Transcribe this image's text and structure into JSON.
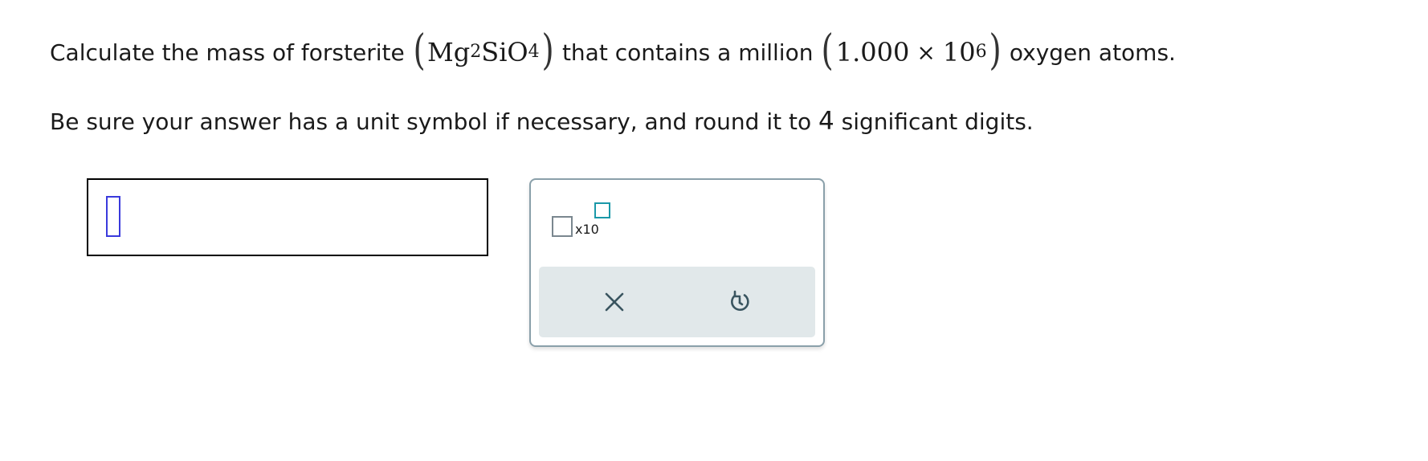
{
  "question": {
    "prefix": "Calculate the mass of forsterite",
    "formula_mg": "Mg",
    "formula_mg_sub": "2",
    "formula_si": "SiO",
    "formula_o_sub": "4",
    "middle": "that contains a million",
    "number_coefficient": "1.000",
    "times_symbol": "×",
    "number_base": "10",
    "number_exponent": "6",
    "suffix": "oxygen atoms."
  },
  "instruction": {
    "before_digit": "Be sure your answer has a unit symbol if necessary, and round it to",
    "digit": "4",
    "after_digit": "significant digits."
  },
  "answer": {
    "value": ""
  },
  "tools": {
    "scientific_notation_label": "x10",
    "clear_icon": "close-icon",
    "undo_icon": "undo-icon"
  },
  "colors": {
    "cursor_slot": "#3a3adc",
    "exponent_box": "#1a98a8",
    "icon": "#3a5560",
    "action_bar": "#e1e8ea",
    "panel_border": "#8aa0aa"
  }
}
